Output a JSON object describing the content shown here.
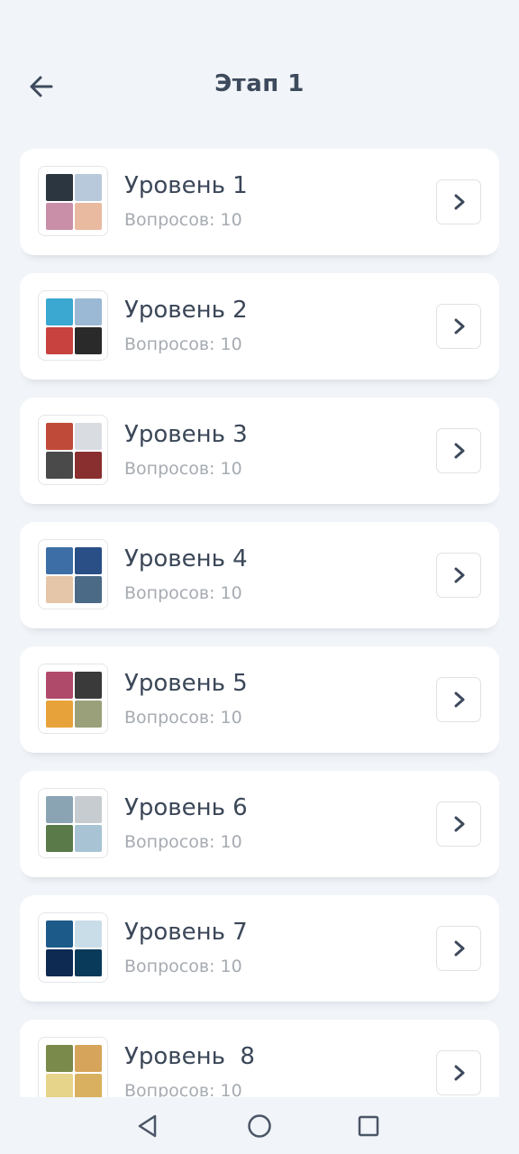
{
  "header": {
    "title": "Этап 1",
    "back_icon": "arrow-left-icon"
  },
  "levels": [
    {
      "title": "Уровень 1",
      "subtitle": "Вопросов: 10",
      "colors": [
        "#2c3640",
        "#b9c9dc",
        "#c98fa8",
        "#e9b9a0"
      ]
    },
    {
      "title": "Уровень 2",
      "subtitle": "Вопросов: 10",
      "colors": [
        "#3aa8d0",
        "#9bb8d4",
        "#c8423f",
        "#2a2a2a"
      ]
    },
    {
      "title": "Уровень 3",
      "subtitle": "Вопросов: 10",
      "colors": [
        "#c04a3a",
        "#d9dde2",
        "#4a4a4a",
        "#8a2f2f"
      ]
    },
    {
      "title": "Уровень 4",
      "subtitle": "Вопросов: 10",
      "colors": [
        "#3d6fa6",
        "#2a4e86",
        "#e6c6a8",
        "#4b6a86"
      ]
    },
    {
      "title": "Уровень 5",
      "subtitle": "Вопросов: 10",
      "colors": [
        "#b04a6a",
        "#3a3a3a",
        "#e8a23a",
        "#9aa07a"
      ]
    },
    {
      "title": "Уровень 6",
      "subtitle": "Вопросов: 10",
      "colors": [
        "#8aa4b4",
        "#c7ccd0",
        "#5a7a4a",
        "#a8c4d4"
      ]
    },
    {
      "title": "Уровень 7",
      "subtitle": "Вопросов: 10",
      "colors": [
        "#1c5a8a",
        "#c9dde9",
        "#0e2a52",
        "#0a3a5a"
      ]
    },
    {
      "title": "Уровень  8",
      "subtitle": "Вопросов: 10",
      "colors": [
        "#7a8a4a",
        "#d6a45a",
        "#e6d48a",
        "#d8b060"
      ]
    }
  ],
  "navbar": {
    "back_icon": "triangle-back-icon",
    "home_icon": "circle-home-icon",
    "recents_icon": "square-recents-icon"
  },
  "colors": {
    "background": "#f1f4f8",
    "card": "#ffffff",
    "text_primary": "#3b4758",
    "text_secondary": "#a6abb2"
  }
}
